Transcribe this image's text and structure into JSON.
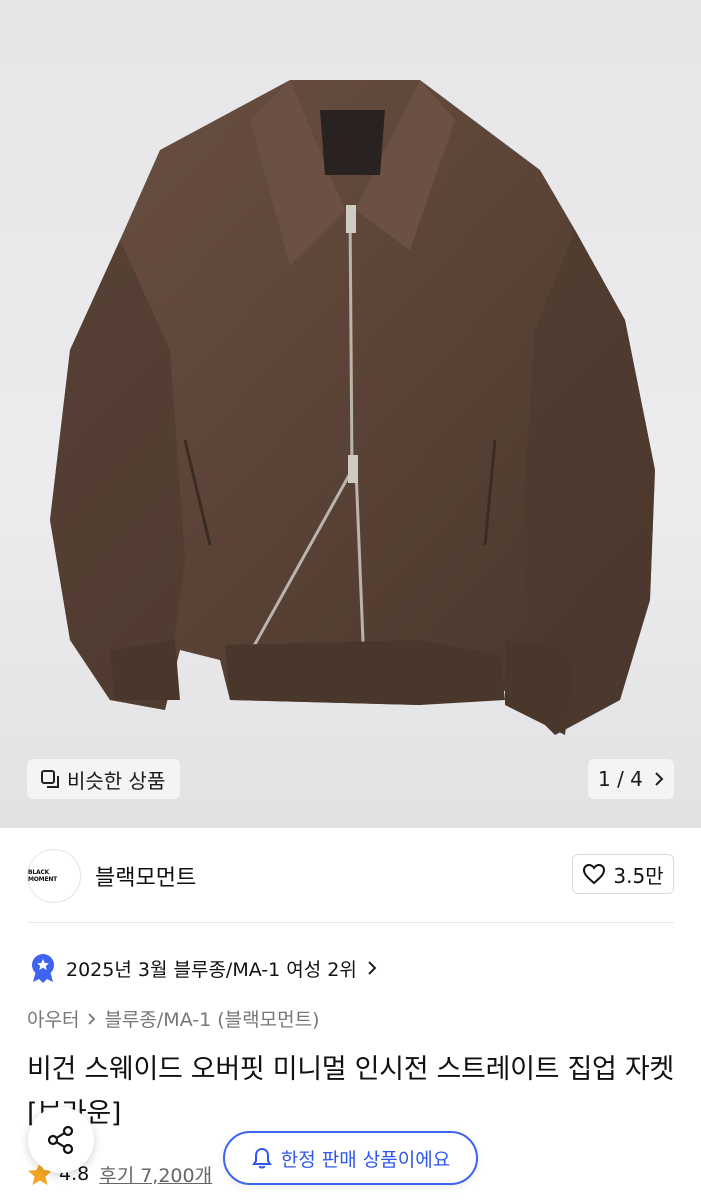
{
  "gallery": {
    "similar_label": "비슷한 상품",
    "counter": "1 / 4"
  },
  "brand": {
    "logo_text": "BLACK MOMENT",
    "name": "블랙모먼트",
    "likes": "3.5만"
  },
  "ranking": {
    "text": "2025년 3월 블루종/MA-1 여성 2위"
  },
  "breadcrumb": {
    "category": "아우터",
    "subcategory": "블루종/MA-1 (블랙모먼트)"
  },
  "product": {
    "title": "비건 스웨이드 오버핏 미니멀 인시전 스트레이트 집업 자켓 [브라운]"
  },
  "rating": {
    "score": "4.8",
    "reviews": "후기 7,200개"
  },
  "floating": {
    "limited_label": "한정 판매 상품이에요"
  },
  "colors": {
    "accent": "#3d63f0",
    "star": "#f5a623",
    "jacket": "#5a4336"
  }
}
